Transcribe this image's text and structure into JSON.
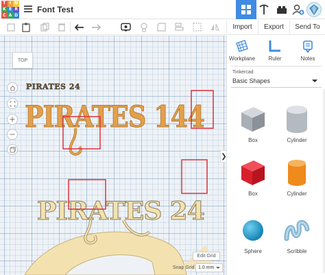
{
  "app": {
    "logo_letters": [
      "T",
      "I",
      "N",
      "K",
      "E",
      "R",
      "C",
      "A",
      "D"
    ],
    "logo_colors": [
      "#e2574c",
      "#f0a13a",
      "#f6cf3a",
      "#3aa65b",
      "#2e8bd6",
      "#7d4bb8",
      "#e2574c",
      "#3aa65b",
      "#2e8bd6"
    ],
    "design_title": "Font Test",
    "accent": "#3f8be4"
  },
  "toolbar": {
    "import_label": "Import",
    "export_label": "Export",
    "sendto_label": "Send To"
  },
  "viewport": {
    "viewcube_label": "TOP",
    "edit_grid_label": "Edit Grid",
    "snap_grid_label": "Snap Grid",
    "snap_grid_value": "1.0 mm"
  },
  "scene": {
    "small_label": "PIRATES 24",
    "large_text": "PIRATES 144",
    "medium_text": "PIRATES 24",
    "orange_color": "#e3a04c",
    "cream_color": "#f3e2b0",
    "highlight_color": "#e0303c"
  },
  "panel": {
    "tools": [
      {
        "label": "Workplane",
        "icon": "workplane-icon"
      },
      {
        "label": "Ruler",
        "icon": "ruler-icon"
      },
      {
        "label": "Notes",
        "icon": "notes-icon"
      }
    ],
    "library_source": "Tinkercad",
    "library_selected": "Basic Shapes",
    "shapes": [
      {
        "label": "Box",
        "icon": "box-grey-icon"
      },
      {
        "label": "Cylinder",
        "icon": "cylinder-grey-icon"
      },
      {
        "label": "Box",
        "icon": "box-red-icon"
      },
      {
        "label": "Cylinder",
        "icon": "cylinder-orange-icon"
      },
      {
        "label": "Sphere",
        "icon": "sphere-icon"
      },
      {
        "label": "Scribble",
        "icon": "scribble-icon"
      }
    ],
    "collapse_glyph": "❯"
  }
}
